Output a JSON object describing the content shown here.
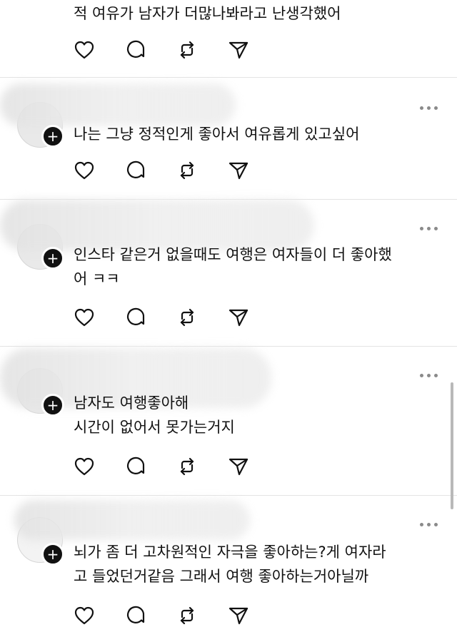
{
  "posts": [
    {
      "text": "적 여유가 남자가 더많나봐라고 난생각했어"
    },
    {
      "text": "나는 그냥 정적인게 좋아서 여유롭게 있고싶어"
    },
    {
      "text": "인스타 같은거 없을때도 여행은 여자들이 더 좋아했\n어 ㅋㅋ"
    },
    {
      "text": "남자도 여행좋아해\n시간이 없어서 못가는거지"
    },
    {
      "text": "뇌가 좀 더 고차원적인 자극을 좋아하는?게 여자라\n고 들었던거같음 그래서 여행 좋아하는거아닐까"
    }
  ],
  "icons": {
    "like": "heart-icon",
    "comment": "comment-icon",
    "repost": "repost-icon",
    "share": "send-icon",
    "more": "more-icon",
    "follow": "plus-icon"
  },
  "follow_symbol": "+"
}
